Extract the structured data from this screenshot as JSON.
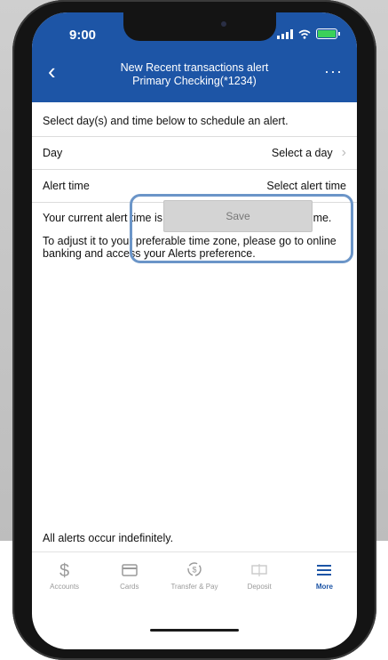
{
  "status": {
    "time": "9:00"
  },
  "header": {
    "back_icon": "chevron-left-icon",
    "title": "New Recent transactions alert",
    "subtitle": "Primary Checking(*1234)",
    "more_icon": "more-dots-icon"
  },
  "instruction": "Select day(s) and time below to schedule an alert.",
  "rows": [
    {
      "label": "Day",
      "value": "Select a day"
    },
    {
      "label": "Alert time",
      "value": "Select alert time"
    }
  ],
  "notes": [
    "Your current alert time is based on Alaskan Standard Time.",
    "To adjust it to your preferable time zone, please go to online banking and access your Alerts preference."
  ],
  "save_label": "Save",
  "footer_note": "All alerts occur indefinitely.",
  "tabs": [
    {
      "label": "Accounts",
      "icon": "dollar-icon",
      "active": false
    },
    {
      "label": "Cards",
      "icon": "card-icon",
      "active": false
    },
    {
      "label": "Transfer & Pay",
      "icon": "transfer-icon",
      "active": false
    },
    {
      "label": "Deposit",
      "icon": "deposit-icon",
      "active": false
    },
    {
      "label": "More",
      "icon": "menu-icon",
      "active": true
    }
  ],
  "colors": {
    "brand_blue": "#1d55a6",
    "highlight": "#6b95c8",
    "battery_green": "#3bd15a"
  }
}
